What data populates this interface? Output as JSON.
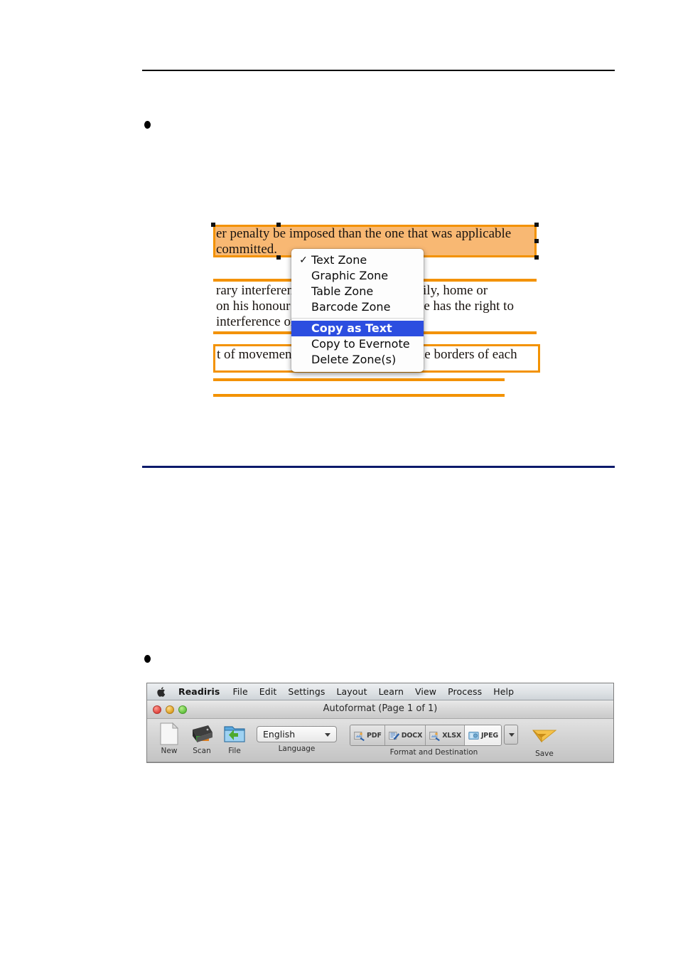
{
  "page": {
    "rules": [
      {
        "name": "top-rule",
        "color": "#000000"
      },
      {
        "name": "mid-rule",
        "color": "#0c1a6b"
      }
    ],
    "bullets": [
      "",
      ""
    ]
  },
  "zone_figure": {
    "caption": "",
    "document_lines": [
      "er penalty be imposed than the one that was applicable",
      "committed.",
      "rary interference with his privacy, family, home or",
      "on his honour and reputation. Everyone has the right to",
      " interference or attacks.",
      "t of movement and residence within the borders of each"
    ],
    "selected_zone_fill": "#f7b267",
    "zone_border_color": "#f39200"
  },
  "context_menu": {
    "items": [
      {
        "label": "Text Zone",
        "checked": true,
        "highlighted": false
      },
      {
        "label": "Graphic Zone",
        "checked": false,
        "highlighted": false
      },
      {
        "label": "Table Zone",
        "checked": false,
        "highlighted": false
      },
      {
        "label": "Barcode Zone",
        "checked": false,
        "highlighted": false
      },
      {
        "label": "Copy as Text",
        "checked": false,
        "highlighted": true
      },
      {
        "label": "Copy to Evernote",
        "checked": false,
        "highlighted": false
      },
      {
        "label": "Delete Zone(s)",
        "checked": false,
        "highlighted": false
      }
    ],
    "check_glyph": "✓",
    "highlight_color": "#2c4ee0"
  },
  "readiris": {
    "menubar": {
      "apple_icon": "apple-logo-icon",
      "items": [
        "Readiris",
        "File",
        "Edit",
        "Settings",
        "Layout",
        "Learn",
        "View",
        "Process",
        "Help"
      ]
    },
    "titlebar": {
      "title": "Autoformat (Page 1 of 1)",
      "buttons": [
        "close",
        "minimize",
        "zoom"
      ]
    },
    "toolbar": {
      "new_label": "New",
      "scan_label": "Scan",
      "file_label": "File",
      "language_group_label": "Language",
      "language_value": "English",
      "format_group_label": "Format and Destination",
      "formats": [
        {
          "label": "PDF",
          "active": false
        },
        {
          "label": "DOCX",
          "active": false
        },
        {
          "label": "XLSX",
          "active": false
        },
        {
          "label": "JPEG",
          "active": true
        }
      ],
      "save_label": "Save"
    }
  }
}
